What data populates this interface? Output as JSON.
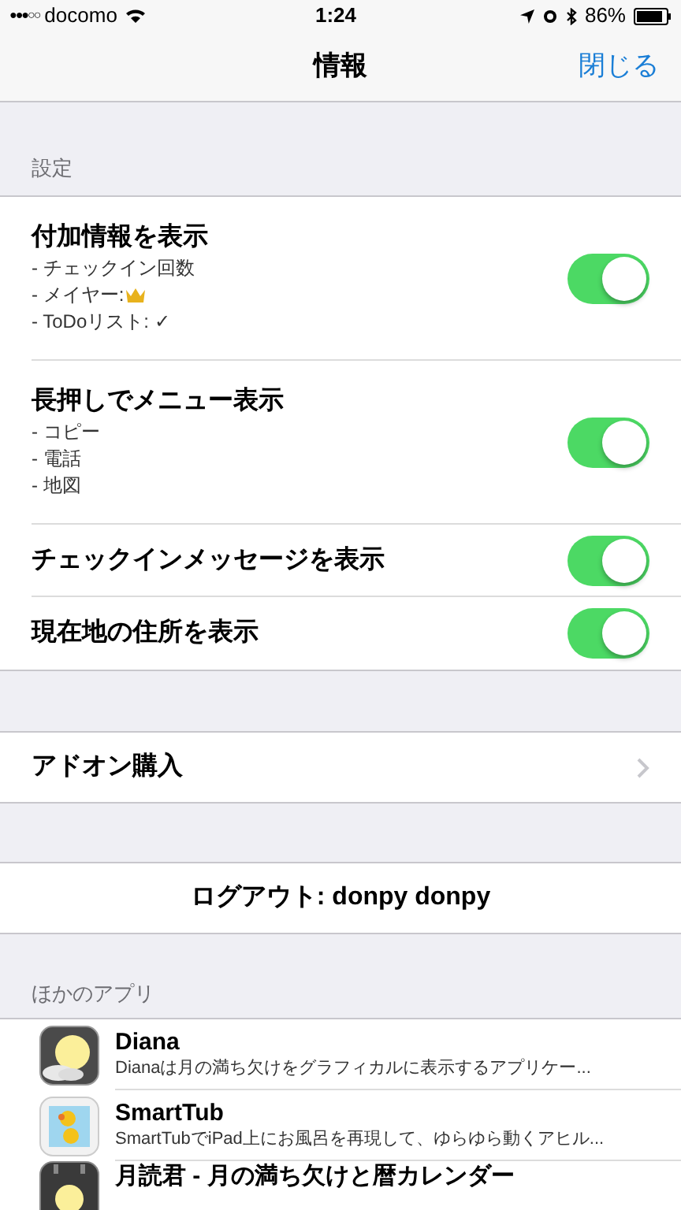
{
  "status_bar": {
    "carrier": "docomo",
    "signal_bars": "●●●○○",
    "time": "1:24",
    "battery": "86%"
  },
  "nav": {
    "title": "情報",
    "close": "閉じる"
  },
  "settings": {
    "header": "設定",
    "rows": [
      {
        "title": "付加情報を表示",
        "lines": [
          {
            "text": "- チェックイン回数"
          },
          {
            "text": "- メイヤー:",
            "crown": true
          },
          {
            "text": "- ToDoリスト: ✓"
          }
        ],
        "on": true
      },
      {
        "title": "長押しでメニュー表示",
        "lines": [
          {
            "text": "- コピー"
          },
          {
            "text": "- 電話"
          },
          {
            "text": "- 地図"
          }
        ],
        "on": true
      },
      {
        "title": "チェックインメッセージを表示",
        "on": true
      },
      {
        "title": "現在地の住所を表示",
        "on": true
      }
    ]
  },
  "addon": {
    "label": "アドオン購入"
  },
  "logout": {
    "label": "ログアウト: donpy donpy"
  },
  "other_apps": {
    "header": "ほかのアプリ",
    "apps": [
      {
        "kind": "moon",
        "name": "Diana",
        "description": "Dianaは月の満ち欠けをグラフィカルに表示するアプリケー..."
      },
      {
        "kind": "duck",
        "name": "SmartTub",
        "description": "SmartTubでiPad上にお風呂を再現して、ゆらゆら動くアヒル..."
      },
      {
        "kind": "calendar",
        "name": "月読君 - 月の満ち欠けと暦カレンダー"
      }
    ]
  }
}
